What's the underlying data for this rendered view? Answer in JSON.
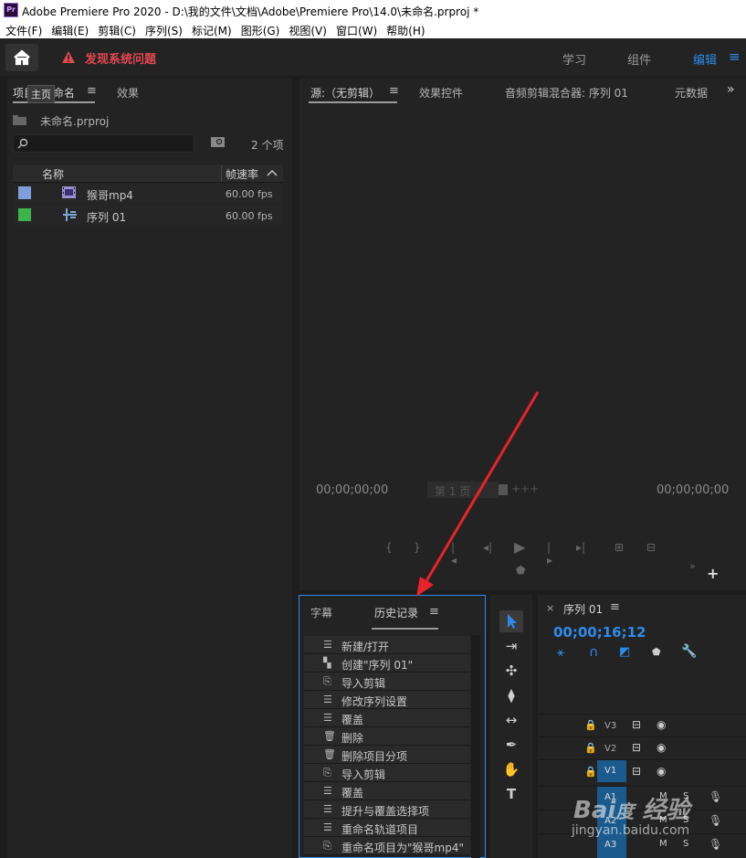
{
  "titlebar": {
    "logo": "Pr",
    "title": "Adobe Premiere Pro 2020 - D:\\我的文件\\文档\\Adobe\\Premiere Pro\\14.0\\未命名.prproj *"
  },
  "menu": [
    "文件(F)",
    "编辑(E)",
    "剪辑(C)",
    "序列(S)",
    "标记(M)",
    "图形(G)",
    "视图(V)",
    "窗口(W)",
    "帮助(H)"
  ],
  "workspace": {
    "warning": "发现系统问题",
    "tabs": [
      "学习",
      "组件",
      "编辑"
    ],
    "active": "编辑",
    "menu_icon": "≡"
  },
  "project": {
    "tab_label": "项目: 未命名",
    "tooltip": "主页",
    "effects_tab": "效果",
    "file": "未命名.prproj",
    "search_placeholder": "",
    "count": "2 个项",
    "col_name": "名称",
    "col_fps": "帧速率",
    "items": [
      {
        "name": "猴哥mp4",
        "fps": "60.00 fps",
        "color": "#7f9fdb",
        "icon": "film-icon"
      },
      {
        "name": "序列 01",
        "fps": "60.00 fps",
        "color": "#3cb44b",
        "icon": "sequence-icon"
      }
    ]
  },
  "source": {
    "tab_label": "源:（无剪辑）",
    "tabs": [
      "效果控件",
      "音频剪辑混合器: 序列 01",
      "元数据"
    ],
    "timecode_left": "00;00;00;00",
    "timecode_right": "00;00;00;00",
    "page": "第 1 页"
  },
  "bottom_tabs": {
    "captions": "字幕",
    "history": "历史记录"
  },
  "history": [
    {
      "label": "新建/打开",
      "icon": "list-icon"
    },
    {
      "label": "创建\"序列 01\"",
      "icon": "new-item-icon"
    },
    {
      "label": "导入剪辑",
      "icon": "import-icon"
    },
    {
      "label": "修改序列设置",
      "icon": "list-icon"
    },
    {
      "label": "覆盖",
      "icon": "list-icon"
    },
    {
      "label": "删除",
      "icon": "trash-icon"
    },
    {
      "label": "删除项目分项",
      "icon": "trash-icon"
    },
    {
      "label": "导入剪辑",
      "icon": "import-icon"
    },
    {
      "label": "覆盖",
      "icon": "list-icon"
    },
    {
      "label": "提升与覆盖选择项",
      "icon": "list-icon"
    },
    {
      "label": "重命名轨道项目",
      "icon": "list-icon"
    },
    {
      "label": "重命名项目为\"猴哥mp4\"",
      "icon": "import-icon"
    }
  ],
  "timeline": {
    "tab": "序列 01",
    "timecode": "00;00;16;12",
    "tracks": [
      "V3",
      "V2",
      "V1",
      "A1",
      "A2",
      "A3"
    ]
  },
  "watermark": "jingyan.baidu.com",
  "colors": {
    "accent": "#2d8ceb",
    "warning": "#e34850",
    "arrow": "#e8232a"
  }
}
